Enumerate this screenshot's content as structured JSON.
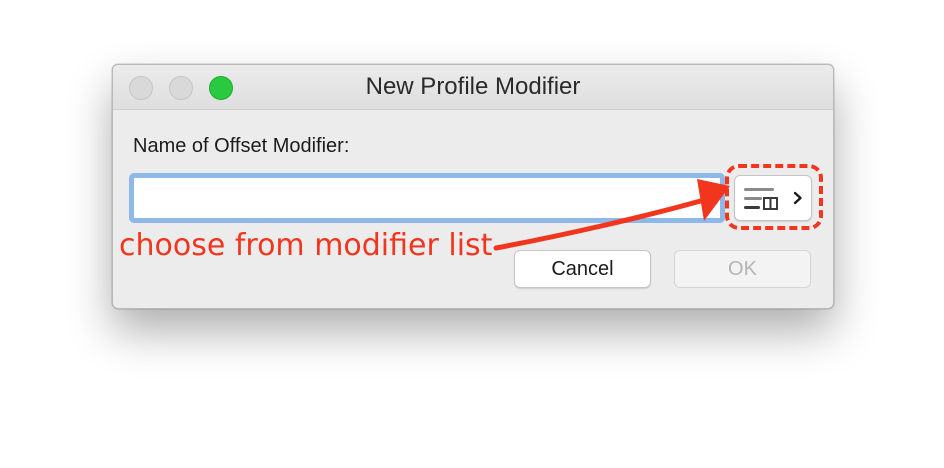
{
  "window": {
    "title": "New Profile Modifier",
    "traffic_lights": [
      "close",
      "minimize",
      "zoom"
    ]
  },
  "form": {
    "label": "Name of Offset Modifier:",
    "name_value": "",
    "name_placeholder": ""
  },
  "list_button": {
    "icon": "list-icon",
    "chevron": "chevron-right-icon"
  },
  "buttons": {
    "cancel": "Cancel",
    "ok": "OK"
  },
  "annotation": {
    "text": "choose from modifier list",
    "color": "#f2361e"
  },
  "colors": {
    "focus_ring": "#8fb8ea",
    "zoom_button": "#29c940",
    "window_bg": "#ececec"
  }
}
